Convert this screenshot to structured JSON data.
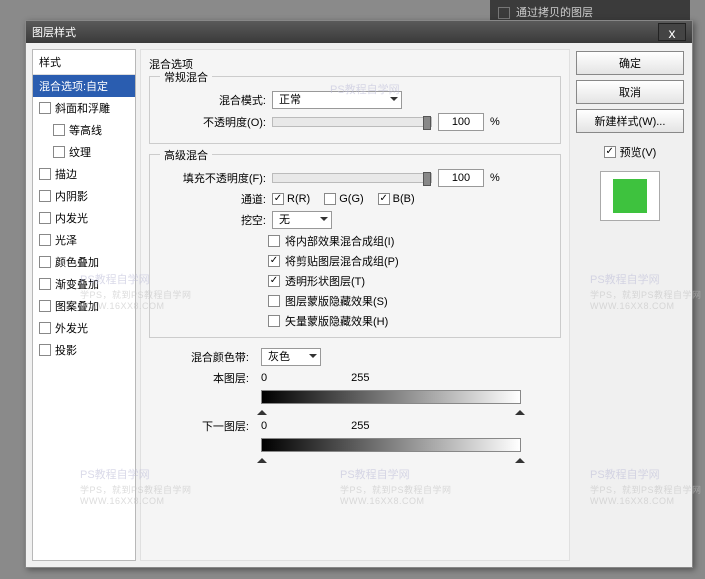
{
  "titlebar": {
    "title": "图层样式",
    "close": "x"
  },
  "bg_panel": "通过拷贝的图层",
  "styles": {
    "header": "样式",
    "selected": "混合选项:自定",
    "items": [
      {
        "label": "斜面和浮雕",
        "checked": false
      },
      {
        "label": "等高线",
        "checked": false,
        "indent": true
      },
      {
        "label": "纹理",
        "checked": false,
        "indent": true
      },
      {
        "label": "描边",
        "checked": false
      },
      {
        "label": "内阴影",
        "checked": false
      },
      {
        "label": "内发光",
        "checked": false
      },
      {
        "label": "光泽",
        "checked": false
      },
      {
        "label": "颜色叠加",
        "checked": false
      },
      {
        "label": "渐变叠加",
        "checked": false
      },
      {
        "label": "图案叠加",
        "checked": false
      },
      {
        "label": "外发光",
        "checked": false
      },
      {
        "label": "投影",
        "checked": false
      }
    ]
  },
  "center": {
    "title": "混合选项",
    "normal": {
      "title": "常规混合",
      "mode_label": "混合模式:",
      "mode_value": "正常",
      "opacity_label": "不透明度(O):",
      "opacity_value": "100",
      "opacity_unit": "%"
    },
    "advanced": {
      "title": "高级混合",
      "fill_label": "填充不透明度(F):",
      "fill_value": "100",
      "fill_unit": "%",
      "channel_label": "通道:",
      "channels": [
        {
          "label": "R(R)",
          "checked": true
        },
        {
          "label": "G(G)",
          "checked": false
        },
        {
          "label": "B(B)",
          "checked": true
        }
      ],
      "knockout_label": "挖空:",
      "knockout_value": "无",
      "options": [
        {
          "label": "将内部效果混合成组(I)",
          "checked": false
        },
        {
          "label": "将剪贴图层混合成组(P)",
          "checked": true
        },
        {
          "label": "透明形状图层(T)",
          "checked": true
        },
        {
          "label": "图层蒙版隐藏效果(S)",
          "checked": false
        },
        {
          "label": "矢量蒙版隐藏效果(H)",
          "checked": false
        }
      ]
    },
    "blendif": {
      "label": "混合颜色带:",
      "value": "灰色",
      "this_label": "本图层:",
      "this_low": "0",
      "this_high": "255",
      "under_label": "下一图层:",
      "under_low": "0",
      "under_high": "255"
    }
  },
  "right": {
    "ok": "确定",
    "cancel": "取消",
    "newstyle": "新建样式(W)...",
    "preview": "预览(V)"
  },
  "watermark": {
    "line1": "PS教程自学网",
    "line2": "学PS，就到PS教程自学网",
    "line3": "WWW.16XX8.COM"
  }
}
